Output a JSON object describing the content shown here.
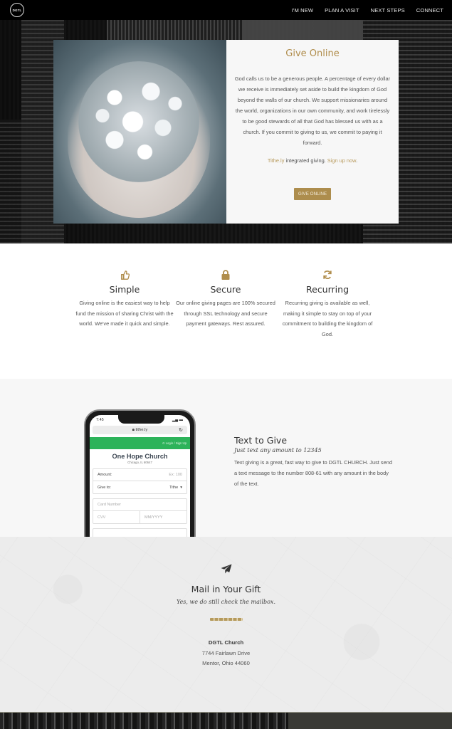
{
  "nav": {
    "logo_text": "DGTL",
    "links": [
      "I'M NEW",
      "PLAN A VISIT",
      "NEXT STEPS",
      "CONNECT"
    ]
  },
  "give_online": {
    "title": "Give Online",
    "body": "God calls us to be a generous people. A percentage of every dollar we receive is immediately set aside to build the kingdom of God beyond the walls of our church. We support missionaries around the world, organizations in our own community, and work tirelessly to be good stewards of all that God has blessed us with as a church. If you commit to giving to us, we commit to paying it forward.",
    "tithely_link": "Tithe.ly",
    "integrated_text": " integrated giving. ",
    "signup_link": "Sign up now",
    "period": ".",
    "button_label": "GIVE ONLINE",
    "image_alt": "hands-holding-flowers"
  },
  "features": [
    {
      "icon": "thumbs-up-icon",
      "title": "Simple",
      "body": "Giving online is the easiest way to help fund the mission of sharing Christ with the world. We've made it quick and simple."
    },
    {
      "icon": "lock-icon",
      "title": "Secure",
      "body": "Our online giving pages are 100% secured through SSL technology and secure payment gateways. Rest assured."
    },
    {
      "icon": "refresh-icon",
      "title": "Recurring",
      "body": "Recurring giving is available as well, making it simple to stay on top of your commitment to building the kingdom of God."
    }
  ],
  "text_to_give": {
    "title": "Text to Give",
    "subtitle": "Just text any amount to 12345",
    "body": "Text giving is a great, fast way to give to DGTL CHURCH. Just send a text message to the number 808-61 with any amount in the body of the text.",
    "phone": {
      "time": "7:45",
      "url": "tithe.ly",
      "login_label": "Login / Sign Up",
      "church_name": "One Hope Church",
      "church_location": "Chicago, IL 60647",
      "amount_label": "Amount:",
      "amount_placeholder": "Ex: 100",
      "give_to_label": "Give to:",
      "give_to_value": "Tithe",
      "card_placeholder": "Card Number",
      "cvv_placeholder": "CVV",
      "expiry_placeholder": "MM/YYYY"
    }
  },
  "mail": {
    "title": "Mail in Your Gift",
    "subtitle": "Yes, we do still check the mailbox.",
    "address_name": "DGTL Church",
    "address_line1": "7744 Fairlawn Drive",
    "address_line2": "Mentor, Ohio 44060"
  },
  "colors": {
    "accent_gold": "#b08d4c",
    "button_gold": "#ad8d4d",
    "tithely_green": "#2db35a",
    "nav_bg": "#000000"
  }
}
